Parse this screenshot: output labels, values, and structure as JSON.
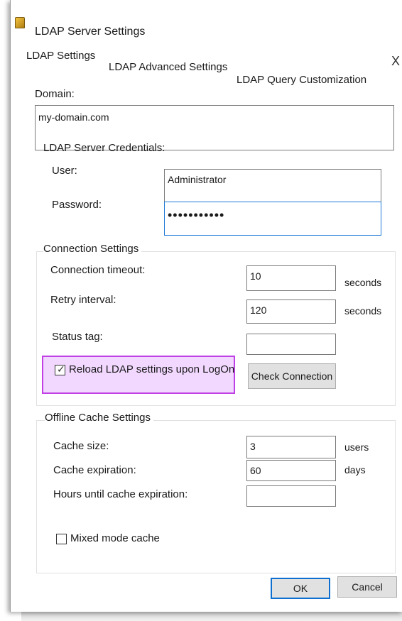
{
  "window": {
    "title": "LDAP Server Settings",
    "close_glyph": "X"
  },
  "tabs": [
    {
      "label": "LDAP Settings"
    },
    {
      "label": "LDAP Advanced Settings"
    },
    {
      "label": "LDAP Query Customization"
    }
  ],
  "domain": {
    "label": "Domain:",
    "value": "my-domain.com"
  },
  "credentials": {
    "legend": "LDAP Server Credentials:",
    "user_label": "User:",
    "user_value": "Administrator",
    "password_label": "Password:",
    "password_value": "•••••••••••"
  },
  "connection": {
    "legend": "Connection Settings",
    "timeout_label": "Connection timeout:",
    "timeout_value": "10",
    "timeout_unit": "seconds",
    "retry_label": "Retry interval:",
    "retry_value": "120",
    "retry_unit": "seconds",
    "status_label": "Status tag:",
    "status_value": "",
    "reload_label": "Reload LDAP settings upon LogOn",
    "reload_checked": true,
    "check_button": "Check Connection"
  },
  "offline_cache": {
    "legend": "Offline Cache Settings",
    "size_label": "Cache size:",
    "size_value": "3",
    "size_unit": "users",
    "expiration_label": "Cache expiration:",
    "expiration_value": "60",
    "expiration_unit": "days",
    "hours_label": "Hours until cache expiration:",
    "hours_value": "",
    "mixed_mode_label": "Mixed mode cache",
    "mixed_mode_checked": false
  },
  "footer": {
    "ok_label": "OK",
    "cancel_label": "Cancel"
  },
  "colors": {
    "highlight_border": "#c040e6",
    "highlight_fill": "#f2d8ff",
    "focus_blue": "#1e79d6"
  }
}
